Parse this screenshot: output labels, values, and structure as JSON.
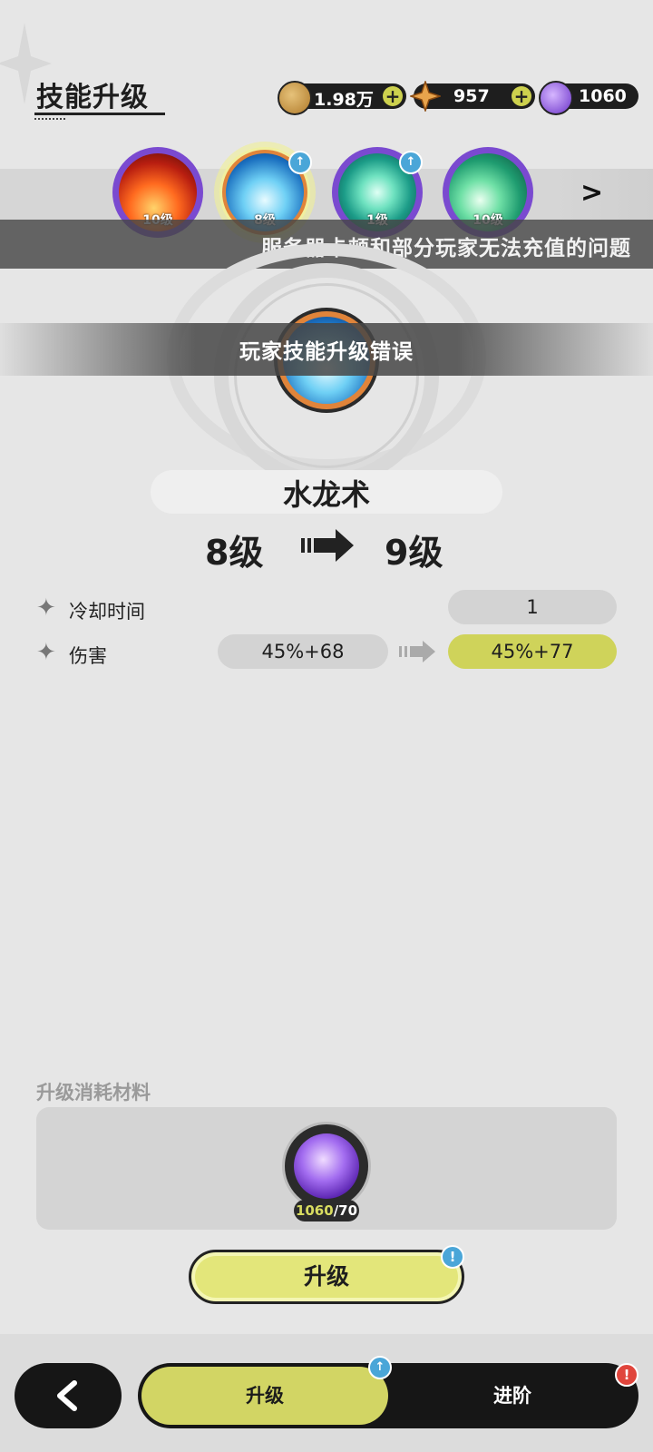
{
  "header": {
    "title": "技能升级",
    "currencies": [
      {
        "icon": "gold-coin-icon",
        "value": "1.98万",
        "has_plus": true
      },
      {
        "icon": "star-crystal-icon",
        "value": "957",
        "has_plus": true
      },
      {
        "icon": "purple-orb-icon",
        "value": "1060",
        "has_plus": false
      }
    ]
  },
  "skills": [
    {
      "name": "fire",
      "level": "10级",
      "upgrade_available": false,
      "selected": false
    },
    {
      "name": "water-dragon",
      "level": "8级",
      "upgrade_available": true,
      "selected": true
    },
    {
      "name": "whirlwind",
      "level": "1级",
      "upgrade_available": true,
      "selected": false
    },
    {
      "name": "leaf",
      "level": "10级",
      "upgrade_available": false,
      "selected": false
    }
  ],
  "notices": {
    "top": "服务器卡顿和部分玩家无法充值的问题",
    "middle": "玩家技能升级错误"
  },
  "detail": {
    "name": "水龙术",
    "level_from": "8级",
    "level_to": "9级",
    "stats": [
      {
        "label": "冷却时间",
        "from": "",
        "to": "1",
        "highlight": false
      },
      {
        "label": "伤害",
        "from": "45%+68",
        "to": "45%+77",
        "highlight": true
      }
    ]
  },
  "materials": {
    "title": "升级消耗材料",
    "item_icon": "purple-orb-icon",
    "have": "1060",
    "need": "/70"
  },
  "upgrade_button": {
    "label": "升级",
    "alert": "!"
  },
  "bottom_tabs": [
    {
      "label": "升级",
      "active": true,
      "badge": "↑"
    },
    {
      "label": "进阶",
      "active": false,
      "badge": "!"
    }
  ],
  "colors": {
    "accent": "#cfd35a",
    "badge_blue": "#4aa6d8",
    "badge_red": "#e0453c"
  }
}
